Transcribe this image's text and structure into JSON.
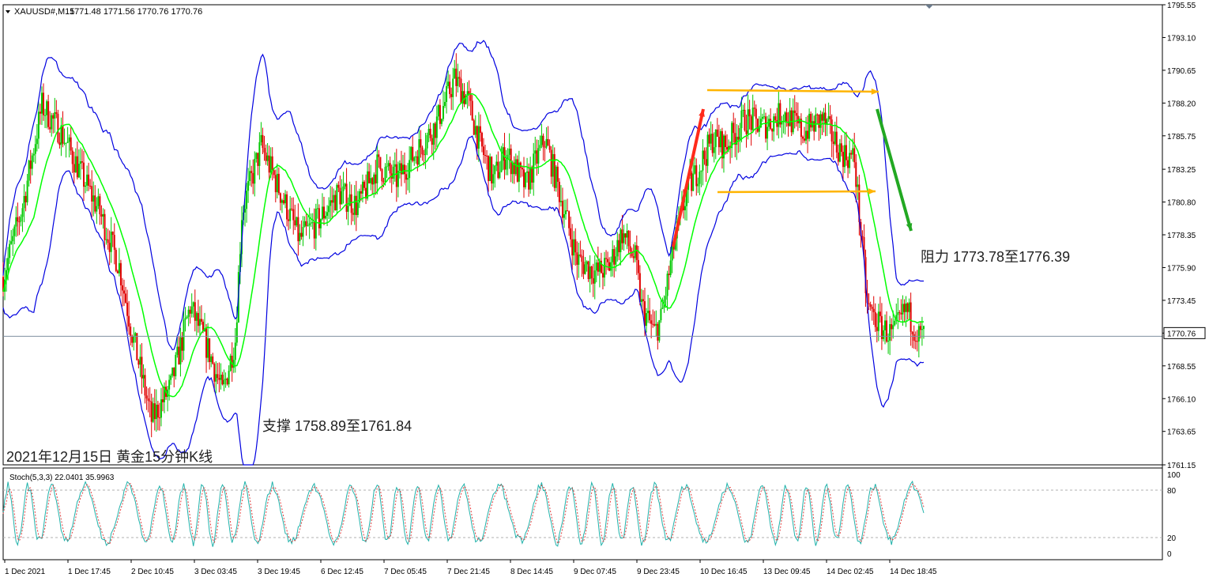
{
  "header": {
    "symbol": "XAUUSD#,M15",
    "ohlc": "1771.48 1771.56 1770.76 1770.76"
  },
  "colors": {
    "background": "#ffffff",
    "band": "#0000e0",
    "candle_up": "#00c800",
    "candle_down": "#e00000",
    "ma": "#00ff00",
    "annotation_up": "#ff2a1a",
    "annotation_down": "#22a822",
    "range_arrow": "#ffb400",
    "current_price_line": "#8090a0",
    "stoch_main": "#20b2aa",
    "stoch_signal": "#e04040",
    "axis_text": "#000000"
  },
  "annotations": {
    "resistance": "阻力 1773.78至1776.39",
    "support": "支撑 1758.89至1761.84",
    "caption": "2021年12月15日 黄金15分钟K线"
  },
  "chart_data": [
    {
      "type": "candlestick",
      "title": "XAUUSD#,M15",
      "ylim": [
        1761.15,
        1795.55
      ],
      "y_ticks": [
        "1795.55",
        "1793.10",
        "1790.65",
        "1788.20",
        "1785.75",
        "1783.25",
        "1780.80",
        "1778.35",
        "1775.90",
        "1773.45",
        "1770.76",
        "1768.55",
        "1766.10",
        "1763.65",
        "1761.15"
      ],
      "y_tick_values": [
        1795.55,
        1793.1,
        1790.65,
        1788.2,
        1785.75,
        1783.25,
        1780.8,
        1778.35,
        1775.9,
        1773.45,
        1771.0,
        1768.55,
        1766.1,
        1763.65,
        1761.15
      ],
      "x_ticks": [
        "1 Dec 2021",
        "1 Dec 17:45",
        "2 Dec 10:45",
        "3 Dec 03:45",
        "3 Dec 19:45",
        "6 Dec 12:45",
        "7 Dec 05:45",
        "7 Dec 21:45",
        "8 Dec 14:45",
        "9 Dec 07:45",
        "9 Dec 23:45",
        "10 Dec 16:45",
        "13 Dec 09:45",
        "14 Dec 02:45",
        "14 Dec 18:45"
      ],
      "current_price": 1770.76,
      "ohlc_last": [
        1771.48,
        1771.56,
        1770.76,
        1770.76
      ],
      "price_path": [
        [
          0,
          1775.2
        ],
        [
          3,
          1780.5
        ],
        [
          6,
          1788.0
        ],
        [
          9,
          1786.0
        ],
        [
          12,
          1783.0
        ],
        [
          15,
          1780.0
        ],
        [
          18,
          1776.0
        ],
        [
          20,
          1771.0
        ],
        [
          23,
          1764.5
        ],
        [
          26,
          1767.0
        ],
        [
          29,
          1773.0
        ],
        [
          32,
          1769.5
        ],
        [
          34,
          1766.5
        ],
        [
          36,
          1770.5
        ],
        [
          37,
          1780.0
        ],
        [
          40,
          1785.0
        ],
        [
          43,
          1781.5
        ],
        [
          46,
          1778.0
        ],
        [
          49,
          1779.5
        ],
        [
          52,
          1781.5
        ],
        [
          55,
          1780.5
        ],
        [
          58,
          1783.5
        ],
        [
          61,
          1782.5
        ],
        [
          64,
          1784.5
        ],
        [
          67,
          1786.5
        ],
        [
          70,
          1790.0
        ],
        [
          72,
          1788.5
        ],
        [
          74,
          1785.0
        ],
        [
          76,
          1782.5
        ],
        [
          78,
          1784.5
        ],
        [
          81,
          1782.0
        ],
        [
          84,
          1785.5
        ],
        [
          86,
          1782.0
        ],
        [
          89,
          1776.5
        ],
        [
          92,
          1775.5
        ],
        [
          94,
          1776.0
        ],
        [
          96,
          1778.5
        ],
        [
          98,
          1776.5
        ],
        [
          99,
          1773.0
        ],
        [
          101,
          1771.0
        ],
        [
          102,
          1772.0
        ],
        [
          104,
          1777.5
        ],
        [
          106,
          1781.5
        ],
        [
          108,
          1783.5
        ],
        [
          110,
          1785.5
        ],
        [
          112,
          1785.0
        ],
        [
          115,
          1787.0
        ],
        [
          118,
          1786.5
        ],
        [
          121,
          1787.5
        ],
        [
          124,
          1786.0
        ],
        [
          127,
          1787.0
        ],
        [
          130,
          1784.5
        ],
        [
          132,
          1784.0
        ],
        [
          134,
          1773.0
        ],
        [
          136,
          1771.5
        ],
        [
          138,
          1770.8
        ],
        [
          140,
          1772.8
        ],
        [
          142,
          1770.76
        ]
      ],
      "overlays": [
        "Bollinger Bands",
        "Moving Average"
      ]
    },
    {
      "type": "line",
      "title": "Stoch(5,3,3) 22.0401 35.9963",
      "ylim": [
        0,
        100
      ],
      "y_ticks": [
        "100",
        "80",
        "20",
        "0"
      ],
      "y_tick_values": [
        100,
        80,
        20,
        0
      ],
      "levels": [
        80,
        20
      ],
      "series": [
        {
          "name": "22.0401",
          "last_value": 22.0401
        },
        {
          "name": "35.9963",
          "last_value": 35.9963
        }
      ]
    }
  ]
}
